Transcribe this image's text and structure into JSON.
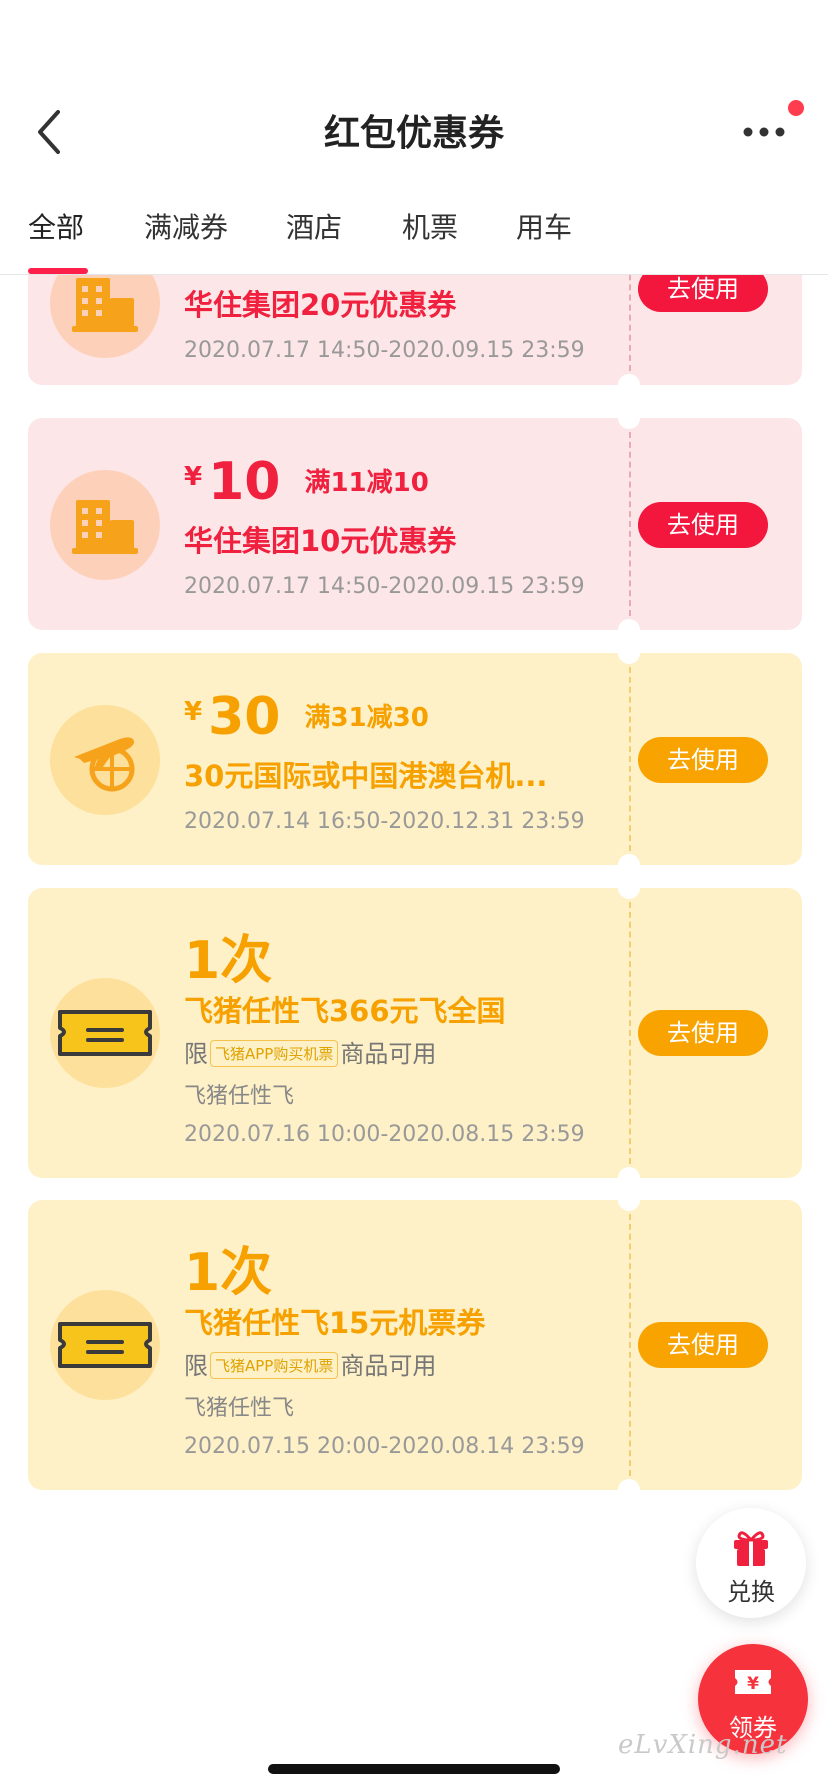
{
  "header": {
    "title": "红包优惠券"
  },
  "tabs": [
    "全部",
    "满减券",
    "酒店",
    "机票",
    "用车"
  ],
  "coupons": [
    {
      "name": "华住集团20元优惠券",
      "date": "2020.07.17 14:50-2020.09.15 23:59",
      "button": "去使用",
      "icon": "hotel-building-icon"
    },
    {
      "currency": "¥",
      "amount": "10",
      "condition": "满11减10",
      "name": "华住集团10元优惠券",
      "date": "2020.07.17 14:50-2020.09.15 23:59",
      "button": "去使用",
      "icon": "hotel-building-icon"
    },
    {
      "currency": "¥",
      "amount": "30",
      "condition": "满31减30",
      "name": "30元国际或中国港澳台机...",
      "date": "2020.07.14 16:50-2020.12.31 23:59",
      "button": "去使用",
      "icon": "plane-globe-icon"
    },
    {
      "count": "1次",
      "name": "飞猪任性飞366元飞全国",
      "limit_prefix": "限",
      "limit_tag": "飞猪APP购买机票",
      "limit_suffix": "商品可用",
      "sub": "飞猪任性飞",
      "date": "2020.07.16 10:00-2020.08.15 23:59",
      "button": "去使用",
      "icon": "ticket-icon"
    },
    {
      "count": "1次",
      "name": "飞猪任性飞15元机票券",
      "limit_prefix": "限",
      "limit_tag": "飞猪APP购买机票",
      "limit_suffix": "商品可用",
      "sub": "飞猪任性飞",
      "date": "2020.07.15 20:00-2020.08.14 23:59",
      "button": "去使用",
      "icon": "ticket-icon"
    }
  ],
  "fabs": {
    "exchange_label": "兑换",
    "claim_label": "领券"
  },
  "watermark": "eLvXing.net",
  "colors": {
    "accent_red": "#f0213f",
    "accent_yellow": "#f6a100",
    "red_card": "#fde6e8",
    "yellow_card": "#fef1c7"
  }
}
